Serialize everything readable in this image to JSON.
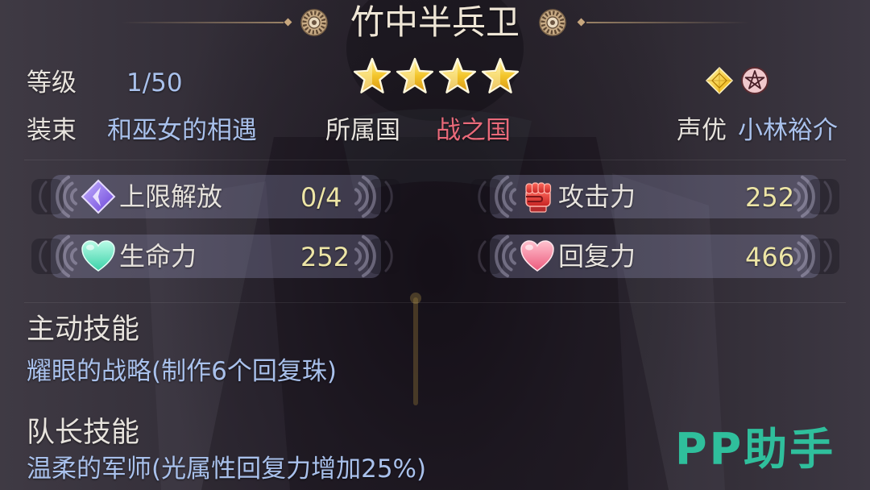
{
  "character": {
    "name": "竹中半兵卫",
    "rarity_stars": 4
  },
  "profile": {
    "level_label": "等级",
    "level_value": "1/50",
    "outfit_label": "装束",
    "outfit_value": "和巫女的相遇",
    "nation_label": "所属国",
    "nation_value": "战之国",
    "voice_label": "声优",
    "voice_value": "小林裕介"
  },
  "attribute_icons": [
    "yellow-diamond-icon",
    "pentagram-icon"
  ],
  "stats": [
    {
      "icon": "purple-diamond-icon",
      "label": "上限解放",
      "value": "0/4"
    },
    {
      "icon": "fist-icon",
      "label": "攻击力",
      "value": "252"
    },
    {
      "icon": "teal-heart-icon",
      "label": "生命力",
      "value": "252"
    },
    {
      "icon": "pink-heart-icon",
      "label": "回复力",
      "value": "466"
    }
  ],
  "skills": {
    "active": {
      "heading": "主动技能",
      "description": "耀眼的战略(制作6个回复珠)"
    },
    "leader": {
      "heading": "队长技能",
      "description": "温柔的军师(光属性回复力增加25%)"
    }
  },
  "watermark": "PP助手",
  "colors": {
    "label": "#e7e3dd",
    "value-blue": "#a9c1ec",
    "nation-red": "#ea6a7a",
    "stat-value": "#ede5a6",
    "title": "#efe6d6",
    "watermark": "#2fbf9c",
    "star-gold": "#f3c62c"
  }
}
